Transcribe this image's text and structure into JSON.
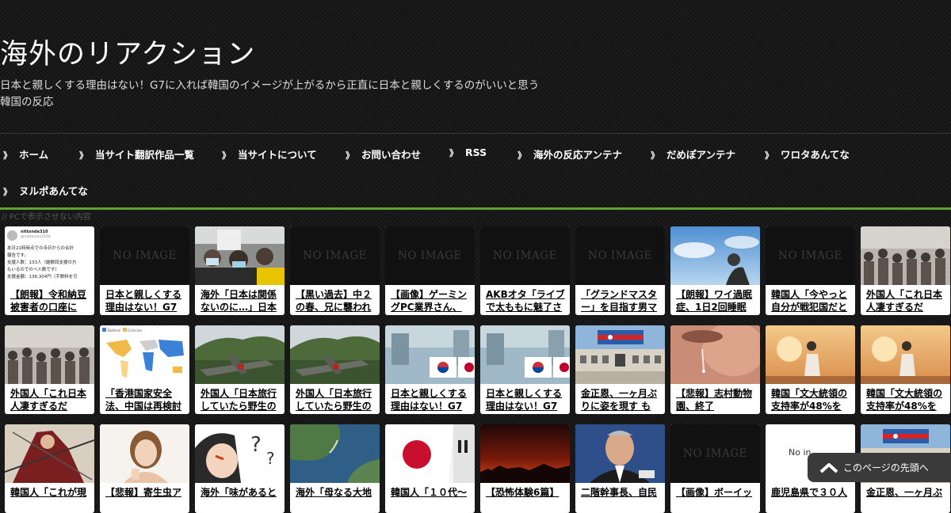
{
  "header": {
    "site_title": "海外のリアクション",
    "description_line1": "日本と親しくする理由はない！G7に入れば韓国のイメージが上がるから正直に日本と親しくするのがいいと思う",
    "description_line2": "韓国の反応"
  },
  "nav": {
    "marker": "》",
    "items": [
      {
        "label": "ホーム"
      },
      {
        "label": "当サイト翻訳作品一覧"
      },
      {
        "label": "当サイトについて"
      },
      {
        "label": "お問い合わせ"
      },
      {
        "label": "RSS"
      },
      {
        "label": "海外の反応アンテナ"
      },
      {
        "label": "だめぽアンテナ"
      },
      {
        "label": "ワロタあんてな"
      },
      {
        "label": "ヌルポあんてな"
      }
    ]
  },
  "hidden_note": "// PCで表示させない内容",
  "no_image_text": "NO IMAGE",
  "tweet_thumb": {
    "user": "nittonde310",
    "handle": "@nattoumo3104",
    "line1": "本日21時時点での寺日からの合計",
    "line2": "報告です。",
    "line3": "支援人数：133人（継数回支援の方",
    "line4": "もいるのでのべ人数です）",
    "line5": "支援金額：138,304円（手数料を引"
  },
  "map_legend": {
    "item1": "Defend",
    "item2": "Criticize"
  },
  "partial_no_img": "No in",
  "tiles": [
    {
      "title": "【朗報】令和納豆被害者の口座に",
      "thumb": "tweet"
    },
    {
      "title": "日本と親しくする理由はない！G7",
      "thumb": "noimage"
    },
    {
      "title": "海外「日本は関係ないのに…」日本",
      "thumb": "protest"
    },
    {
      "title": "【黒い過去】中２の春、兄に襲われ",
      "thumb": "noimage"
    },
    {
      "title": "【画像】ゲーミングPC業界さん、",
      "thumb": "noimage"
    },
    {
      "title": "AKBオタ「ライブで太ももに魅了さ",
      "thumb": "noimage"
    },
    {
      "title": "「グランドマスター」を目指す男マ",
      "thumb": "noimage"
    },
    {
      "title": "【朗報】ワイ過眠症、1日2回睡眠に",
      "thumb": "sky"
    },
    {
      "title": "韓国人「今やっと自分が戦犯国だと",
      "thumb": "noimage"
    },
    {
      "title": "外国人「これ日本人凄すぎるだ",
      "thumb": "crowd"
    },
    {
      "title": "外国人「これ日本人凄すぎるだ",
      "thumb": "crowd"
    },
    {
      "title": "「香港国家安全法、中国は再検討",
      "thumb": "map"
    },
    {
      "title": "外国人「日本旅行していたら野生の",
      "thumb": "plane"
    },
    {
      "title": "外国人「日本旅行していたら野生の",
      "thumb": "plane"
    },
    {
      "title": "日本と親しくする理由はない！G7",
      "thumb": "flags"
    },
    {
      "title": "日本と親しくする理由はない！G7",
      "thumb": "flags"
    },
    {
      "title": "金正恩、一ヶ月ぶりに姿を現す も完",
      "thumb": "dprk"
    },
    {
      "title": "【悲報】志村動物園、終了",
      "thumb": "tear"
    },
    {
      "title": "韓国「文大統領の支持率が48%を記",
      "thumb": "sunset"
    },
    {
      "title": "韓国「文大統領の支持率が48%を記",
      "thumb": "sunset"
    },
    {
      "title": "韓国人「これが現",
      "thumb": "samurai"
    },
    {
      "title": "【悲報】寄生虫ア",
      "thumb": "woman"
    },
    {
      "title": "海外「味があると",
      "thumb": "anime"
    },
    {
      "title": "海外「母なる大地",
      "thumb": "aerial"
    },
    {
      "title": "韓国人「１０代～",
      "thumb": "japanflag"
    },
    {
      "title": "【恐怖体験6篇】",
      "thumb": "dusk"
    },
    {
      "title": "二階幹事長、自民",
      "thumb": "politician"
    },
    {
      "title": "【画像】ボーイッ",
      "thumb": "noimage"
    },
    {
      "title": "鹿児島県で３０人",
      "thumb": "noin"
    },
    {
      "title": "金正恩、一ヶ月ぶ",
      "thumb": "dprk"
    }
  ],
  "to_top": {
    "label": "このページの先頭へ"
  },
  "colors": {
    "accent_green": "#5fa32e",
    "background": "#141414"
  }
}
